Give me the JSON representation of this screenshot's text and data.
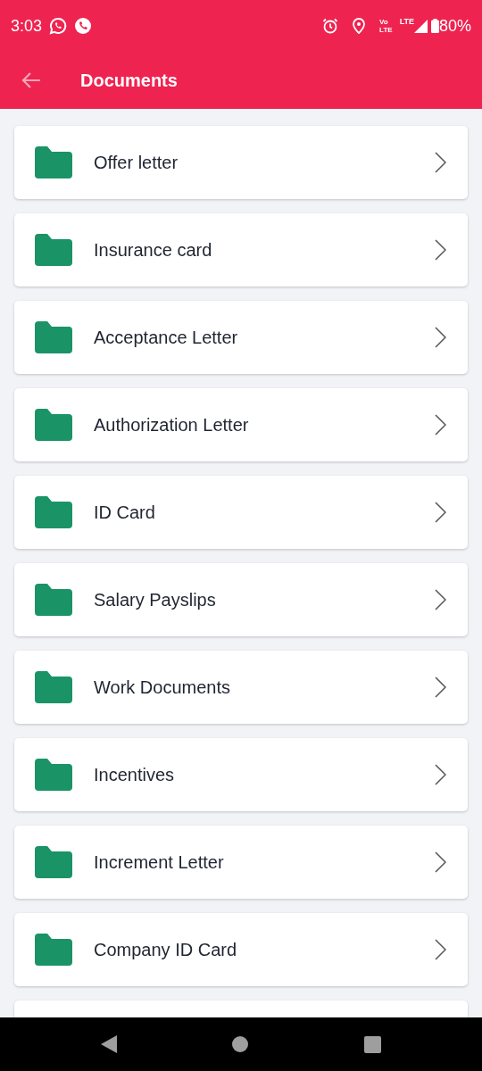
{
  "status_bar": {
    "time": "3:03",
    "volte_top": "Vo",
    "volte_bottom": "LTE",
    "network": "LTE",
    "battery": "80%"
  },
  "app_bar": {
    "title": "Documents"
  },
  "folders": [
    {
      "label": "Offer letter"
    },
    {
      "label": "Insurance card"
    },
    {
      "label": "Acceptance Letter"
    },
    {
      "label": "Authorization Letter"
    },
    {
      "label": "ID Card"
    },
    {
      "label": "Salary Payslips"
    },
    {
      "label": "Work Documents"
    },
    {
      "label": "Incentives"
    },
    {
      "label": "Increment Letter"
    },
    {
      "label": "Company ID Card"
    }
  ]
}
